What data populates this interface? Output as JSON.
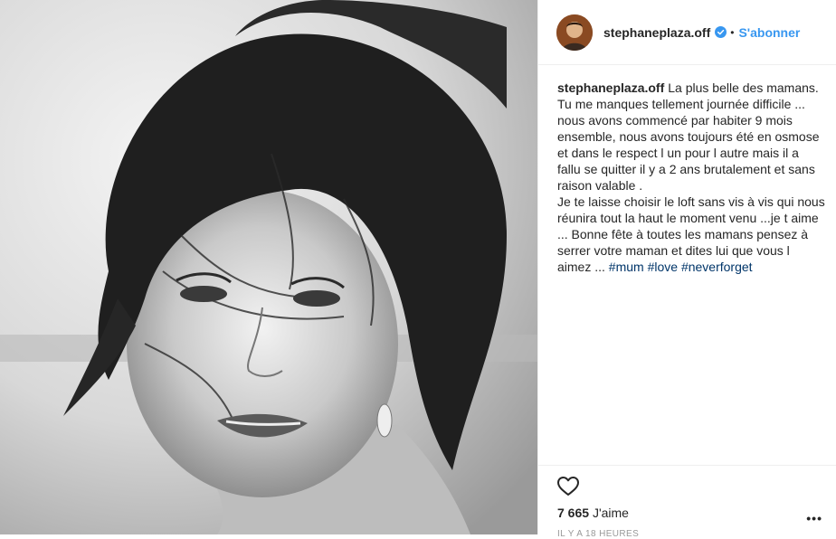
{
  "header": {
    "username": "stephaneplaza.off",
    "separator": "•",
    "follow_label": "S'abonner"
  },
  "caption": {
    "username": "stephaneplaza.off",
    "text": "La plus belle des mamans. Tu me manques tellement journée difficile ... nous avons commencé par habiter 9 mois ensemble, nous avons toujours été en osmose et dans le respect l un pour l autre mais il a fallu se quitter il y a 2 ans brutalement et sans raison valable .\nJe te laisse choisir le loft sans vis à vis qui nous réunira tout la haut le moment venu ...je t aime ... Bonne fête à toutes les mamans pensez à serrer votre maman et dites lui que vous l aimez ... ",
    "hashtags": [
      "#mum",
      "#love",
      "#neverforget"
    ]
  },
  "actions": {
    "likes_count": "7 665",
    "likes_label": "J'aime",
    "timestamp": "IL Y A 18 HEURES",
    "more_label": "•••"
  },
  "photo": {
    "description_icon": "black-and-white-portrait"
  },
  "colors": {
    "accent": "#3897f0",
    "hashtag": "#003569",
    "text": "#262626",
    "muted": "#999999",
    "divider": "#efefef"
  }
}
